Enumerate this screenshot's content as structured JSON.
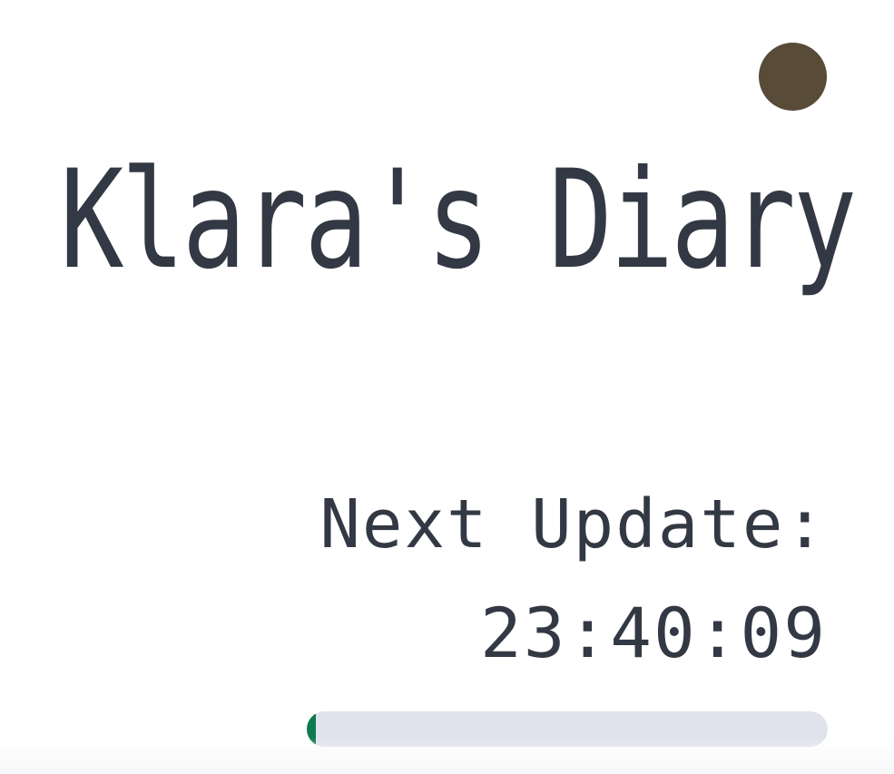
{
  "header": {
    "title": "Klara's Diary",
    "avatar_color": "#584b37"
  },
  "update": {
    "label": "Next Update:",
    "countdown": "23:40:09"
  },
  "progress": {
    "fraction": 0.018,
    "track_color": "#e0e3ec",
    "fill_color": "#0f7a4f"
  }
}
